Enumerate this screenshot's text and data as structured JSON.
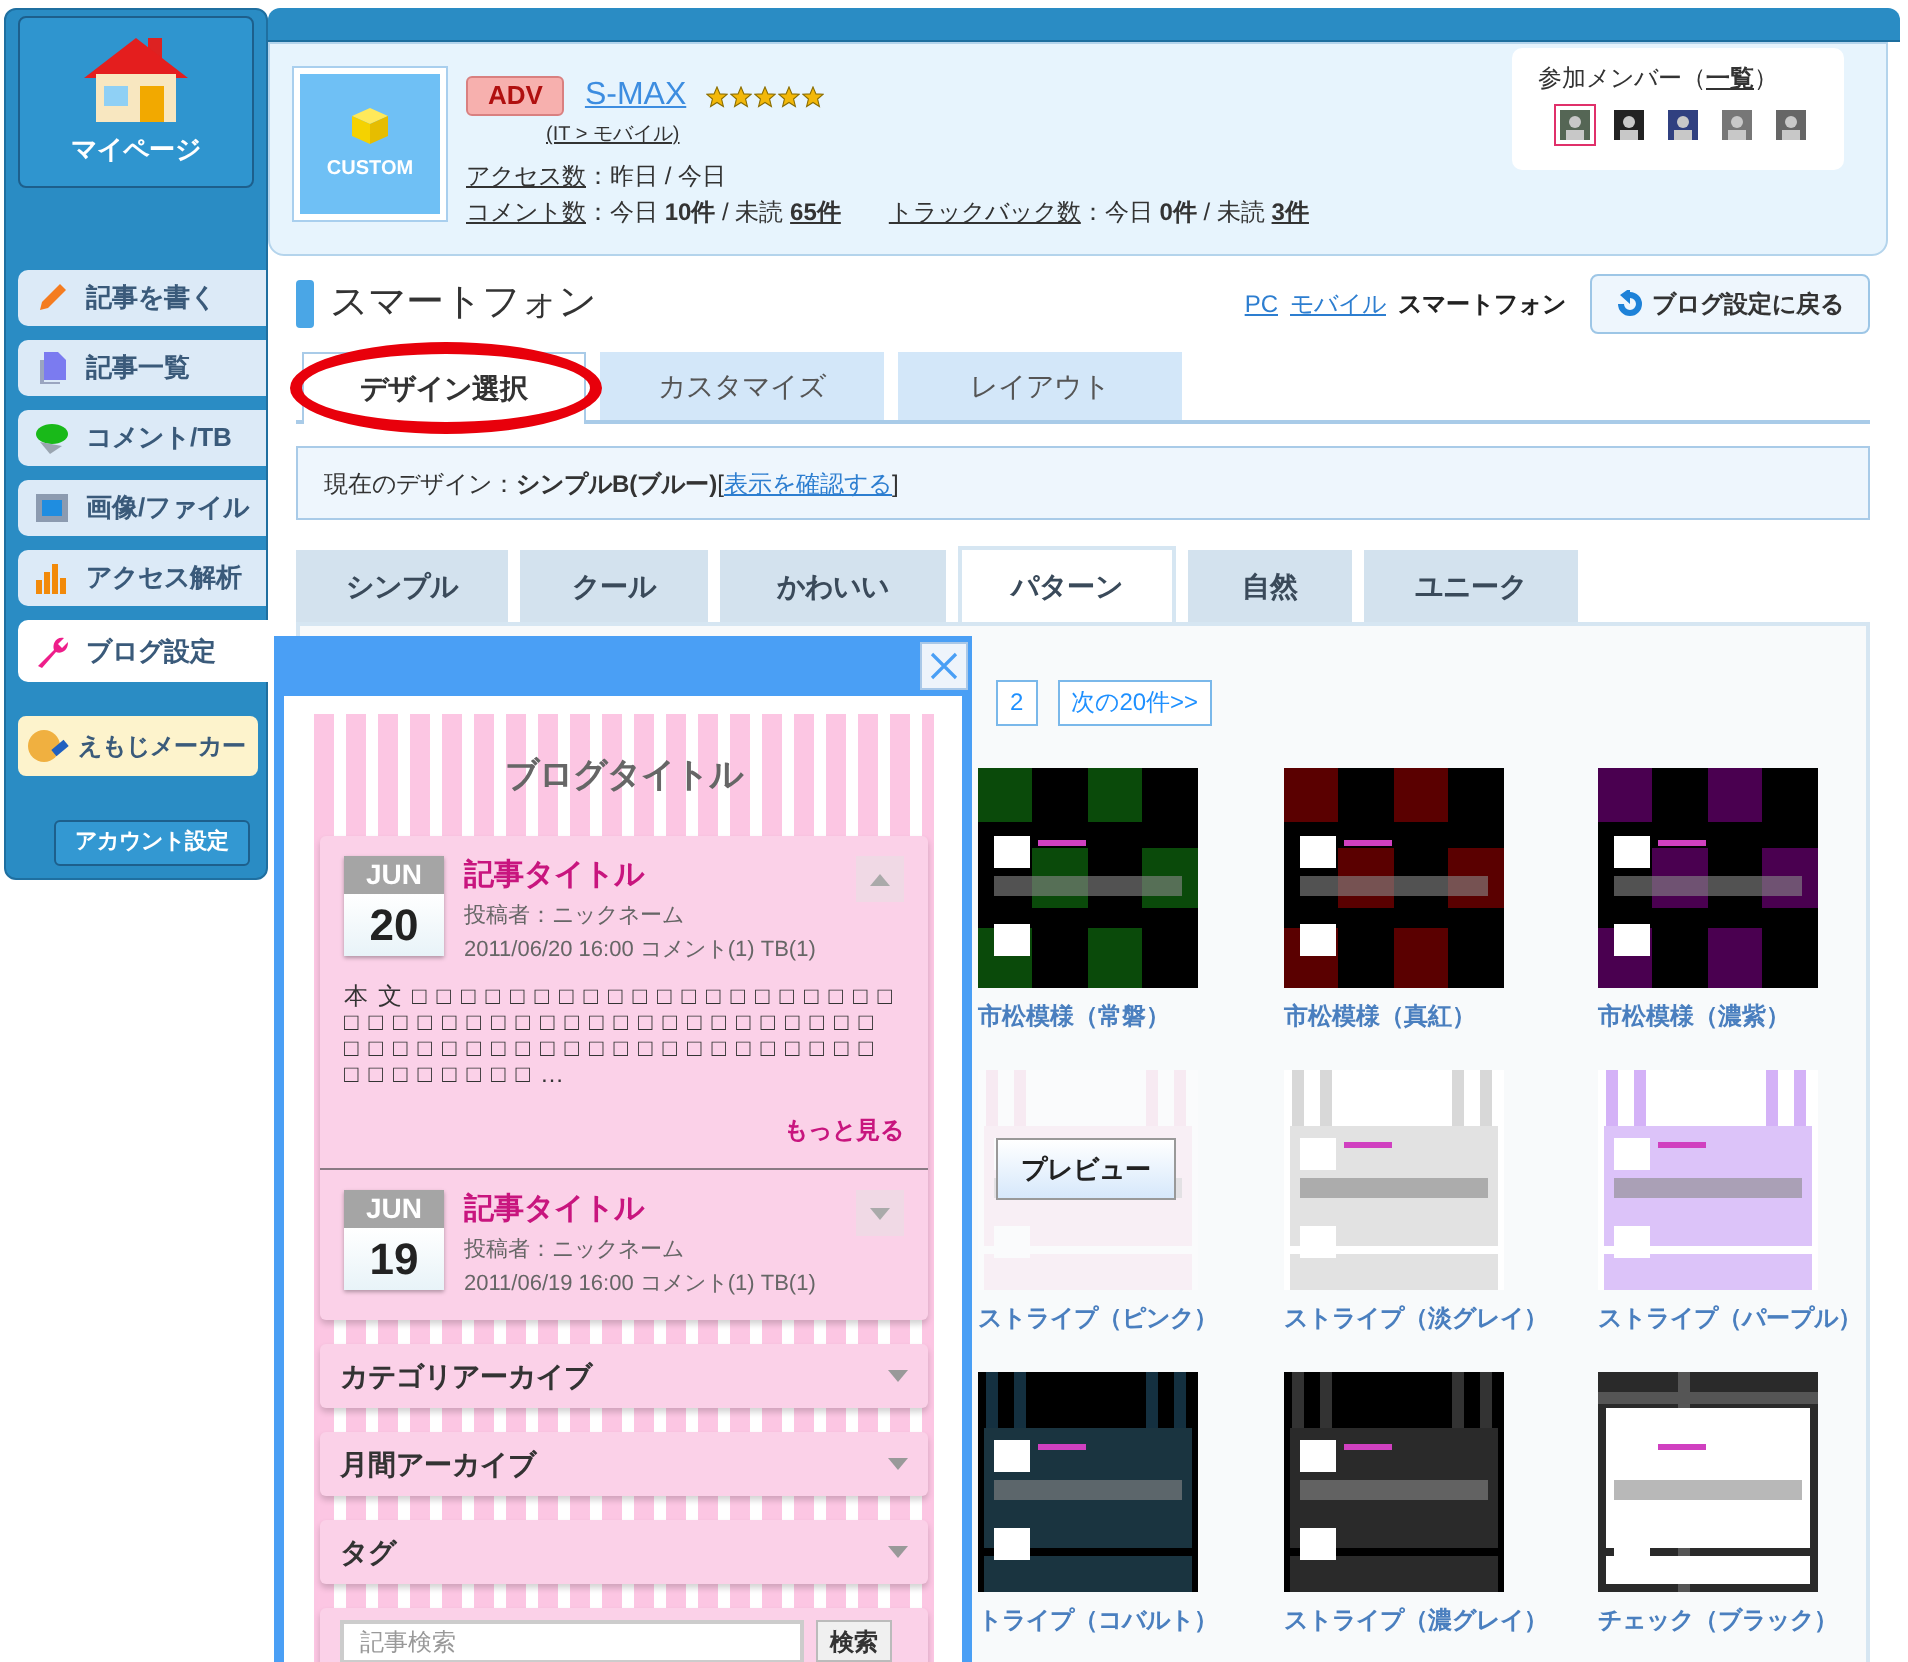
{
  "sidebar": {
    "home": {
      "label": "マイページ"
    },
    "items": [
      {
        "label": "記事を書く",
        "kind": "pencil",
        "selected": false
      },
      {
        "label": "記事一覧",
        "kind": "page",
        "selected": false
      },
      {
        "label": "コメント/TB",
        "kind": "bubble",
        "selected": false
      },
      {
        "label": "画像/ファイル",
        "selected": false
      },
      {
        "label": "アクセス解析",
        "kind": "bars",
        "selected": false
      },
      {
        "label": "ブログ設定",
        "kind": "wrench",
        "selected": true
      }
    ],
    "emoji_maker": {
      "label": "えもじメーカー"
    },
    "account_button": "アカウント設定"
  },
  "header": {
    "logo": "CUSTOM",
    "badge": "ADV",
    "blog_name": "S-MAX",
    "stars": 5,
    "category": "(IT > モバイル)",
    "stats": [
      {
        "label": "アクセス数",
        "text": "：昨日 / 今日"
      },
      {
        "label": "コメント数",
        "text": "：今日 **10件** / 未読 ",
        "link": "65件"
      },
      {
        "label": "トラックバック数",
        "text": "：今日 **0件** / 未読 ",
        "link": "3件"
      }
    ],
    "members": {
      "title": "参加メンバー（",
      "link": "一覧",
      "suffix": "）",
      "avatars": [
        {
          "selected": true
        },
        {
          "selected": false
        },
        {
          "selected": false
        },
        {
          "selected": false
        },
        {
          "selected": false
        }
      ]
    }
  },
  "page": {
    "title": "スマートフォン",
    "device_links": [
      {
        "label": "PC",
        "selected": false
      },
      {
        "label": "モバイル",
        "selected": false
      },
      {
        "label": "スマートフォン",
        "selected": true
      }
    ],
    "back_button": "ブログ設定に戻る"
  },
  "tabs": [
    {
      "label": "デザイン選択",
      "selected": true,
      "circled": true
    },
    {
      "label": "カスタマイズ",
      "selected": false,
      "circled": false
    },
    {
      "label": "レイアウト",
      "selected": false,
      "circled": false
    }
  ],
  "current_design": {
    "text": "現在のデザイン：**シンプルB(ブルー)**[",
    "link": "表示を確認する",
    "suffix": "]"
  },
  "categories": [
    {
      "label": "シンプル",
      "selected": false
    },
    {
      "label": "クール",
      "selected": false
    },
    {
      "label": "かわいい",
      "selected": false
    },
    {
      "label": "パターン",
      "selected": true
    },
    {
      "label": "自然",
      "selected": false
    },
    {
      "label": "ユニーク",
      "selected": false
    }
  ],
  "pagination": [
    {
      "label": "2"
    },
    {
      "label": "次の20件>>"
    }
  ],
  "themes": [
    {
      "name": "市松模様（常磐）",
      "hovered": false
    },
    {
      "name": "市松模様（真紅）",
      "hovered": false
    },
    {
      "name": "市松模様（濃紫）",
      "hovered": false
    },
    {
      "name": "ストライプ（ピンク）",
      "hovered": true,
      "preview_button": "プレビュー"
    },
    {
      "name": "ストライプ（淡グレイ）",
      "hovered": false
    },
    {
      "name": "ストライプ（パープル）",
      "hovered": false
    },
    {
      "name": "トライプ（コバルト）",
      "hovered": false
    },
    {
      "name": "ストライプ（濃グレイ）",
      "hovered": false
    },
    {
      "name": "チェック（ブラック）",
      "hovered": false
    }
  ],
  "preview_popup": {
    "blog_title": "ブログタイトル",
    "entries": [
      {
        "month": "JUN",
        "day": "20",
        "title": "記事タイトル",
        "author": "投稿者：ニックネーム",
        "meta": "2011/06/20 16:00 コメント(1) TB(1)",
        "expanded": true,
        "body": "本文□□□□□□□□□□□□□□□□□□□□□□□□□□□□□□□□□□□□□□□□□□□□□□□□□□□□□□□□□□□□□□□□□□□□□□□□…",
        "more": "もっと見る"
      },
      {
        "month": "JUN",
        "day": "19",
        "title": "記事タイトル",
        "author": "投稿者：ニックネーム",
        "meta": "2011/06/19 16:00 コメント(1) TB(1)",
        "expanded": false
      }
    ],
    "sections": [
      "カテゴリアーカイブ",
      "月間アーカイブ",
      "タグ"
    ],
    "search": {
      "placeholder": "記事検索",
      "button": "検索"
    }
  }
}
